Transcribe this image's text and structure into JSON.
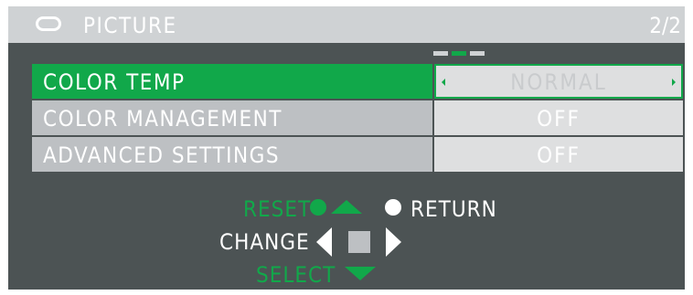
{
  "header": {
    "icon": "picture-icon",
    "title": "PICTURE",
    "page": "2/2"
  },
  "pagination": {
    "pages": 3,
    "active_index": 1,
    "active_color": "#11a84a",
    "inactive_color": "#cfd2d4"
  },
  "menu": {
    "items": [
      {
        "label": "COLOR TEMP",
        "value": "NORMAL",
        "selected": true
      },
      {
        "label": "COLOR MANAGEMENT",
        "value": "OFF",
        "selected": false
      },
      {
        "label": "ADVANCED SETTINGS",
        "value": "OFF",
        "selected": false
      }
    ]
  },
  "controls": {
    "reset": "RESET",
    "return": "RETURN",
    "change": "CHANGE",
    "select": "SELECT"
  },
  "colors": {
    "accent": "#11a84a",
    "panel": "#4c5354",
    "titlebar": "#cfd2d4"
  }
}
